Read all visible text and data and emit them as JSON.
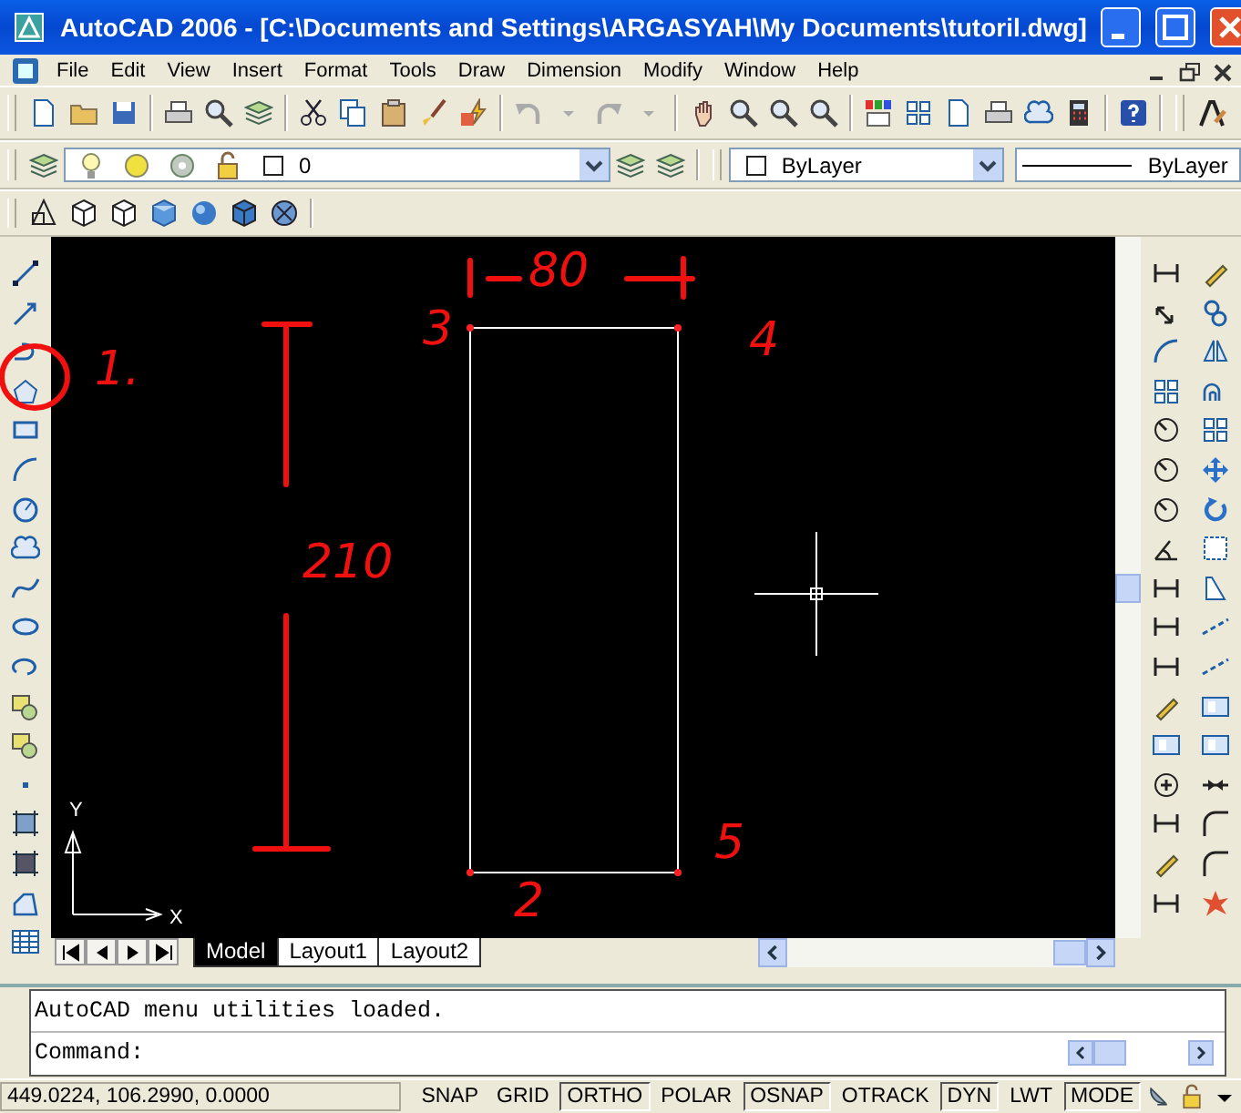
{
  "window": {
    "title": "AutoCAD 2006 - [C:\\Documents and Settings\\ARGASYAH\\My Documents\\tutoril.dwg]"
  },
  "menu": [
    "File",
    "Edit",
    "View",
    "Insert",
    "Format",
    "Tools",
    "Draw",
    "Dimension",
    "Modify",
    "Window",
    "Help"
  ],
  "layers_toolbar": {
    "layer": "0",
    "color_name": "ByLayer",
    "linetype": "ByLayer"
  },
  "drawing": {
    "x_label": "X",
    "y_label": "Y"
  },
  "annotations": [
    {
      "text": "80"
    },
    {
      "text": "3"
    },
    {
      "text": "4"
    },
    {
      "text": "210"
    },
    {
      "text": "2"
    },
    {
      "text": "5"
    },
    {
      "text": "1."
    }
  ],
  "layout_tabs": [
    {
      "label": "Model",
      "selected": true
    },
    {
      "label": "Layout1",
      "selected": false
    },
    {
      "label": "Layout2",
      "selected": false
    }
  ],
  "command": {
    "history": "AutoCAD menu utilities loaded.",
    "prompt": "Command:"
  },
  "status_bar": {
    "coordinates": "449.0224, 106.2990, 0.0000",
    "toggles": [
      {
        "label": "SNAP",
        "on": false
      },
      {
        "label": "GRID",
        "on": false
      },
      {
        "label": "ORTHO",
        "on": true
      },
      {
        "label": "POLAR",
        "on": false
      },
      {
        "label": "OSNAP",
        "on": true
      },
      {
        "label": "OTRACK",
        "on": false
      },
      {
        "label": "DYN",
        "on": true
      },
      {
        "label": "LWT",
        "on": false
      },
      {
        "label": "MODE",
        "on": true
      }
    ]
  }
}
